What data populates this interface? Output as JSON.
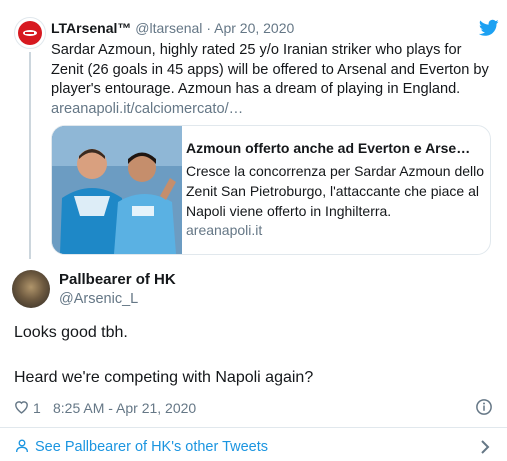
{
  "parent_tweet": {
    "name": "LTArsenal™",
    "handle": "@ltarsenal",
    "separator": "·",
    "date": "Apr 20, 2020",
    "text": "Sardar Azmoun, highly rated 25 y/o Iranian striker who plays for Zenit (26 goals in 45 apps) will be offered to Arsenal and Everton by player's entourage. Azmoun has a dream of playing in England.",
    "link": "areanapoli.it/calciomercato/…",
    "avatar_icon": "arsenal-cannon-icon",
    "brand_icon": "twitter-bird-icon",
    "brand_color": "#1da1f2"
  },
  "card": {
    "title": "Azmoun offerto anche ad Everton e Arse…",
    "description": "Cresce la concorrenza per Sardar Azmoun dello Zenit San Pietroburgo, l'attaccante che piace al Napoli viene offerto in Inghilterra.",
    "domain": "areanapoli.it",
    "image": "zenit-players-photo"
  },
  "main_tweet": {
    "name": "Pallbearer of HK",
    "handle": "@Arsenic_L",
    "line1": "Looks good tbh.",
    "line2": "Heard we're competing with Napoli again?",
    "likes": "1",
    "timestamp": "8:25 AM - Apr 21, 2020",
    "like_icon": "heart-icon",
    "info_icon": "info-icon"
  },
  "footer": {
    "see_more": "See Pallbearer of HK's other Tweets",
    "user_icon": "user-icon",
    "chevron_icon": "chevron-right-icon",
    "link_color": "#1b95e0"
  }
}
